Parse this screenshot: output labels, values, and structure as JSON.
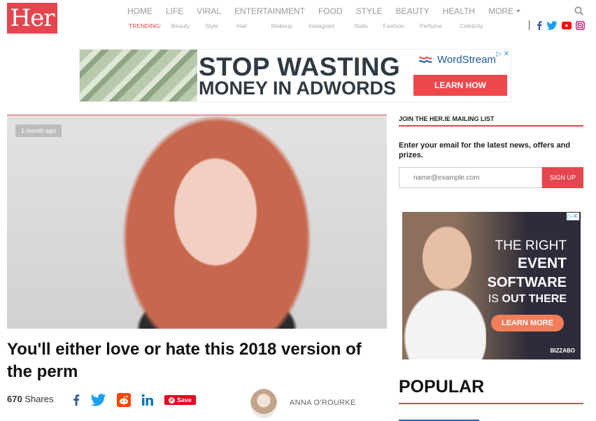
{
  "logo": "Her",
  "nav": [
    "HOME",
    "LIFE",
    "VIRAL",
    "ENTERTAINMENT",
    "FOOD",
    "STYLE",
    "BEAUTY",
    "HEALTH"
  ],
  "nav_more": "MORE",
  "trending": {
    "label": "TRENDING:",
    "items": [
      "Beauty",
      "Style",
      "Hair",
      "Makeup",
      "Instagram",
      "Nails",
      "Fashion",
      "Perfume",
      "Celebrity"
    ]
  },
  "ad_banner": {
    "line1": "STOP WASTING",
    "line2": "MONEY IN ADWORDS",
    "brand": "WordStream",
    "cta": "LEARN HOW"
  },
  "article": {
    "time_badge": "1 month ago",
    "title": "You'll either love or hate this 2018 version of the perm",
    "share_count": "670",
    "share_label": "Shares",
    "save_label": "Save",
    "author": "ANNA O'ROURKE"
  },
  "mailing": {
    "heading": "JOIN THE HER.IE MAILING LIST",
    "text": "Enter your email for the latest news, offers and prizes.",
    "placeholder": "name@example.com",
    "button": "SIGN UP"
  },
  "ad_side": {
    "line1": "THE RIGHT",
    "line2": "EVENT",
    "line3": "SOFTWARE",
    "line4a": "IS",
    "line4b": "OUT THERE",
    "cta": "LEARN MORE",
    "brand": "BIZZABO"
  },
  "popular": {
    "heading": "POPULAR"
  },
  "colors": {
    "brand": "#e5454f",
    "facebook": "#3b5998",
    "twitter": "#1da1f2",
    "reddit": "#ff4500",
    "linkedin": "#0077b5",
    "youtube": "#ff0000",
    "pinterest": "#e60023"
  },
  "icons": [
    "search-icon",
    "facebook-icon",
    "twitter-icon",
    "youtube-icon",
    "instagram-icon",
    "reddit-icon",
    "linkedin-icon",
    "pinterest-icon"
  ]
}
